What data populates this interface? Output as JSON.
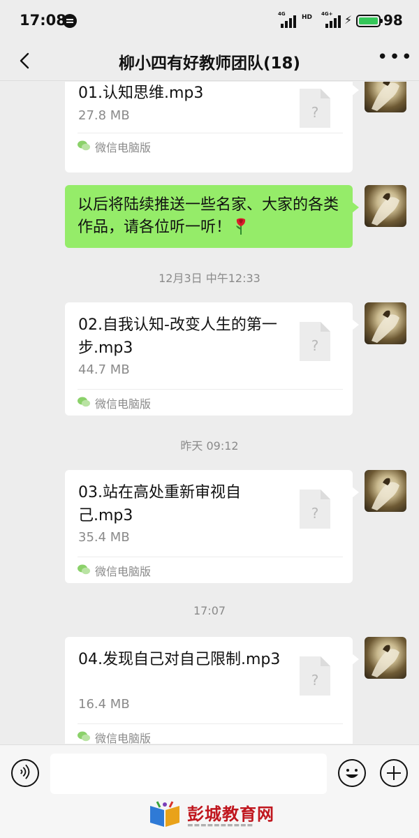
{
  "status_bar": {
    "time": "17:08",
    "network_labels": [
      "4G",
      "4G+"
    ],
    "hd_label": "HD",
    "battery_percent": "98",
    "battery_color": "#34c759"
  },
  "nav": {
    "title": "柳小四有好教师团队(18)",
    "back_icon": "chevron-left-icon",
    "more_icon": "more-dots-icon"
  },
  "messages": [
    {
      "type": "file",
      "file_name": "01.认知思维.mp3",
      "size": "27.8 MB",
      "source": "微信电脑版"
    },
    {
      "type": "text",
      "text": "以后将陆续推送一些名家、大家的各类作品，请各位听一听！",
      "emoji": "rose-icon"
    },
    {
      "type": "time",
      "text": "12月3日 中午12:33"
    },
    {
      "type": "file",
      "file_name": "02.自我认知-改变人生的第一步.mp3",
      "size": "44.7 MB",
      "source": "微信电脑版"
    },
    {
      "type": "time",
      "text": "昨天 09:12"
    },
    {
      "type": "file",
      "file_name": "03.站在高处重新审视自己.mp3",
      "size": "35.4 MB",
      "source": "微信电脑版"
    },
    {
      "type": "time",
      "text": "17:07"
    },
    {
      "type": "file",
      "file_name": "04.发现自己对自己限制.mp3",
      "size": "16.4 MB",
      "source": "微信电脑版"
    }
  ],
  "colors": {
    "sent_bubble": "#95ec69",
    "chat_background": "#ededed",
    "watermark": "#c0161e"
  },
  "watermark": {
    "text": "彭城教育网"
  }
}
